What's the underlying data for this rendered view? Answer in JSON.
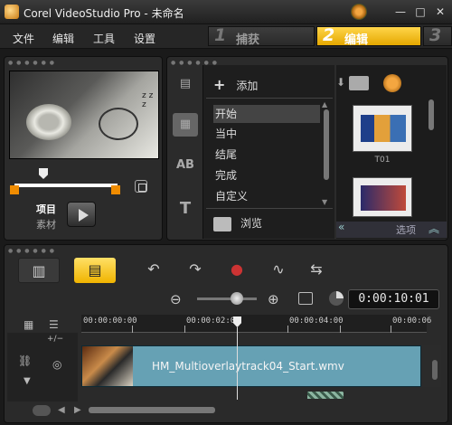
{
  "window": {
    "title": "Corel VideoStudio Pro - 未命名",
    "min_glyph": "—",
    "max_glyph": "□",
    "close_glyph": "✕"
  },
  "menu": [
    "文件",
    "编辑",
    "工具",
    "设置"
  ],
  "steps": [
    {
      "num": "1",
      "label": "捕获",
      "active": false
    },
    {
      "num": "2",
      "label": "编辑",
      "active": true
    },
    {
      "num": "3",
      "label": "",
      "active": false
    }
  ],
  "player": {
    "mode_project": "项目",
    "mode_clip": "素材",
    "zzz_text": "z z z"
  },
  "library": {
    "add_label": "添加",
    "items": [
      "开始",
      "当中",
      "结尾",
      "完成",
      "自定义"
    ],
    "selected_index": 0,
    "browse_label": "浏览",
    "thumbnail_caption": "T01",
    "options_label": "选项",
    "side_icons": [
      "film-icon",
      "transition-icon",
      "title-ab-icon",
      "text-t-icon"
    ],
    "side_glyphs": [
      "▤",
      "▦",
      "AB",
      "T"
    ]
  },
  "timeline": {
    "tool_glyphs": [
      "▥",
      "▤"
    ],
    "action_glyphs": [
      "↶",
      "↷",
      "●",
      "∿",
      "⇆"
    ],
    "zoom_out_glyph": "⊖",
    "zoom_in_glyph": "⊕",
    "zoom_level": 0.6,
    "timecode": "0:00:10:01",
    "ruler_labels": [
      "00:00:00:00",
      "00:00:02:00",
      "00:00:04:00",
      "00:00:06"
    ],
    "clip_title": "HM_Multioverlaytrack04_Start.wmv"
  },
  "colors": {
    "accent": "#f0b400",
    "clip": "#66a1b4"
  }
}
